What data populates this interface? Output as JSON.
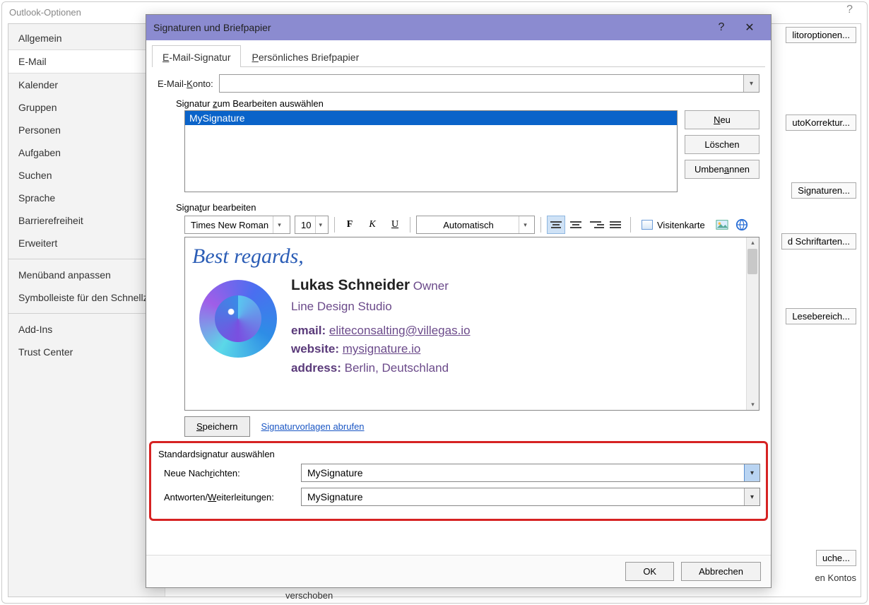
{
  "outer": {
    "title": "Outlook-Optionen",
    "help": "?",
    "nav": [
      "Allgemein",
      "E-Mail",
      "Kalender",
      "Gruppen",
      "Personen",
      "Aufgaben",
      "Suchen",
      "Sprache",
      "Barrierefreiheit",
      "Erweitert",
      "Menüband anpassen",
      "Symbolleiste für den Schnellzugriff",
      "Add-Ins",
      "Trust Center"
    ],
    "nav_active": "E-Mail",
    "right_buttons": {
      "editoroptionen": "litoroptionen...",
      "autokorrektur": "utoKorrektur...",
      "signaturen": "Signaturen...",
      "schriftarten": "d Schriftarten...",
      "lesebereich": "Lesebereich...",
      "suche": "uche..."
    },
    "bg_text": {
      "kontos": "en Kontos",
      "verschoben": "verschoben"
    }
  },
  "dialog": {
    "title": "Signaturen und Briefpapier",
    "help": "?",
    "close": "✕",
    "tabs": {
      "sig": "E-Mail-Signatur",
      "brief": "Persönliches Briefpapier"
    },
    "account_label": "E-Mail-Konto:",
    "select_edit_label": "Signatur zum Bearbeiten auswählen",
    "sig_list_item": "MySignature",
    "buttons": {
      "neu": "Neu",
      "loeschen": "Löschen",
      "umbenennen": "Umbenennen"
    },
    "edit_label": "Signatur bearbeiten",
    "toolbar": {
      "font": "Times New Roman",
      "size": "10",
      "bold": "F",
      "italic": "K",
      "underline": "U",
      "auto": "Automatisch",
      "vcard": "Visitenkarte"
    },
    "editor": {
      "greeting": "Best regards,",
      "name": "Lukas Schneider",
      "role": "Owner",
      "company": "Line Design Studio",
      "email_label": "email:",
      "email_link": "eliteconsalting@villegas.io",
      "website_label": "website:",
      "website_link": "mysignature.io",
      "address_label": "address:",
      "address_value": "Berlin, Deutschland"
    },
    "save": "Speichern",
    "templates_link": "Signaturvorlagen abrufen",
    "default_section": {
      "title": "Standardsignatur auswählen",
      "new_label": "Neue Nachrichten:",
      "new_value": "MySignature",
      "reply_label": "Antworten/Weiterleitungen:",
      "reply_value": "MySignature"
    },
    "footer": {
      "ok": "OK",
      "cancel": "Abbrechen"
    }
  }
}
